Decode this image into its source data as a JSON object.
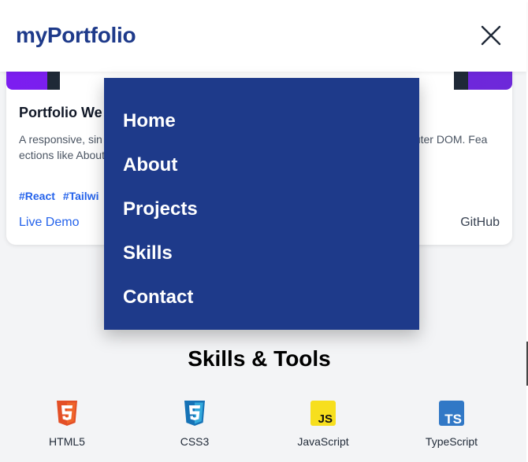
{
  "header": {
    "logo_my": "my",
    "logo_portfolio": "Portfolio",
    "logo_color": "#1e3a8a"
  },
  "menu": {
    "background": "#1e3a8a",
    "items": [
      {
        "label": "Home"
      },
      {
        "label": "About"
      },
      {
        "label": "Projects"
      },
      {
        "label": "Skills"
      },
      {
        "label": "Contact"
      }
    ]
  },
  "project_card": {
    "title": "Portfolio We",
    "description": "A responsive, sin                                                                         SS, and React Router DOM. Fea                                                                  ections like About, Projects,",
    "tags": [
      "#React",
      "#Tailwi"
    ],
    "live_demo_label": "Live Demo",
    "github_label": "GitHub",
    "link_color": "#2563eb"
  },
  "skills": {
    "title": "Skills & Tools",
    "items": [
      {
        "label": "HTML5",
        "icon": "html5-icon",
        "color": "#e34f26"
      },
      {
        "label": "CSS3",
        "icon": "css3-icon",
        "color": "#1572b6"
      },
      {
        "label": "JavaScript",
        "icon": "javascript-icon",
        "color": "#f7df1e"
      },
      {
        "label": "TypeScript",
        "icon": "typescript-icon",
        "color": "#3178c6"
      }
    ]
  }
}
